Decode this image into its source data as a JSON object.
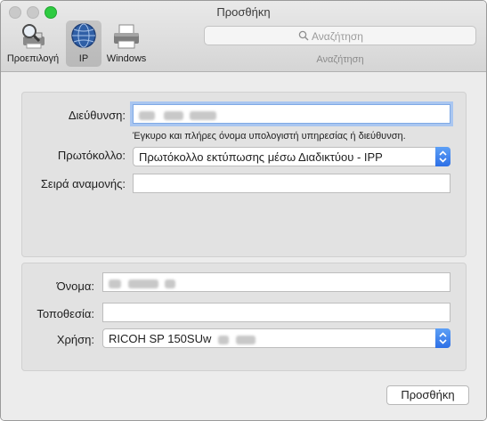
{
  "window": {
    "title": "Προσθήκη"
  },
  "toolbar": {
    "tools": [
      {
        "label": "Προεπιλογή",
        "icon": "magnifier-printer-icon"
      },
      {
        "label": "IP",
        "icon": "globe-icon"
      },
      {
        "label": "Windows",
        "icon": "printer-icon"
      }
    ],
    "search": {
      "placeholder": "Αναζήτηση",
      "caption": "Αναζήτηση"
    }
  },
  "form": {
    "address": {
      "label": "Διεύθυνση:",
      "value": "",
      "hint": "Έγκυρο και πλήρες όνομα υπολογιστή υπηρεσίας ή διεύθυνση."
    },
    "protocol": {
      "label": "Πρωτόκολλο:",
      "value": "Πρωτόκολλο εκτύπωσης μέσω Διαδικτύου - IPP"
    },
    "queue": {
      "label": "Σειρά αναμονής:",
      "value": ""
    },
    "name": {
      "label": "Όνομα:",
      "value": ""
    },
    "location": {
      "label": "Τοποθεσία:",
      "value": ""
    },
    "use": {
      "label": "Χρήση:",
      "value": "RICOH SP 150SUw"
    }
  },
  "actions": {
    "add_label": "Προσθήκη"
  },
  "colors": {
    "accent": "#2d6fe6",
    "focus_ring": "#a9c6f0",
    "zoom_button": "#2ecb41"
  }
}
